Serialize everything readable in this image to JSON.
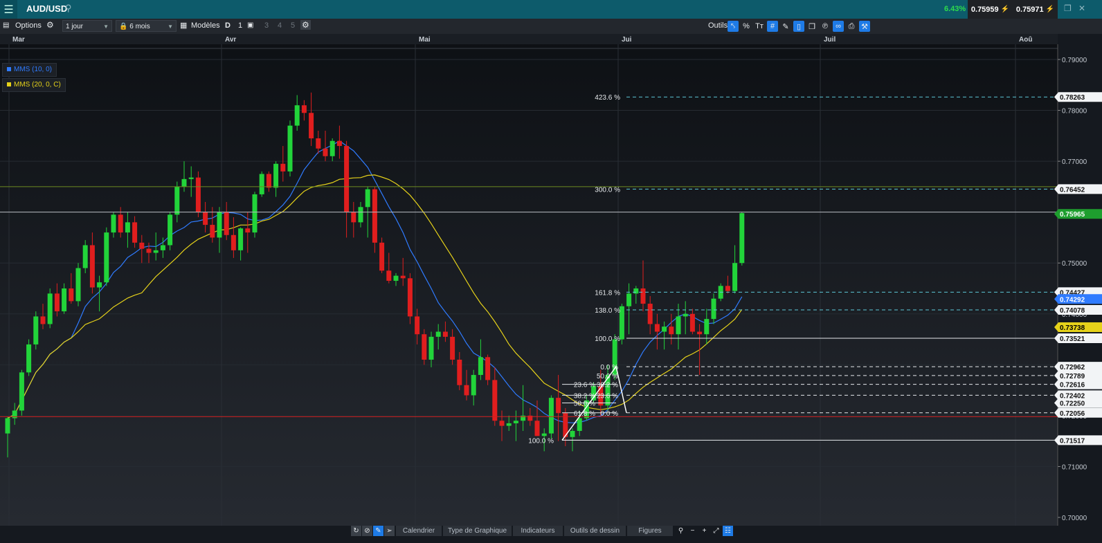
{
  "header": {
    "symbol": "AUD/USD",
    "change_pct": "6.43%",
    "bid": "0.75959",
    "ask": "0.75971"
  },
  "toolbar": {
    "options_label": "Options",
    "interval": "1 jour",
    "period": "6 mois",
    "models_label": "Modèles",
    "layout_d": "D",
    "layout_1": "1",
    "layout_3": "3",
    "layout_4": "4",
    "layout_5": "5",
    "tools_label": "Outils",
    "percent_label": "%",
    "text_tool_label": "Tт"
  },
  "legend": {
    "ma10": "MMS (10, 0)",
    "ma20": "MMS (20, 0, C)"
  },
  "colors": {
    "up": "#22d43a",
    "down": "#e01e1e",
    "ma10": "#2f7bff",
    "ma20": "#e6d21a",
    "accent": "#1e7be6"
  },
  "chart_data": {
    "type": "candlestick",
    "instrument": "AUD/USD",
    "months": [
      "Mar",
      "Avr",
      "Mai",
      "Jui",
      "Juil",
      "Aoû"
    ],
    "y_ticks": [
      "0.79000",
      "0.78000",
      "0.77000",
      "0.76000",
      "0.75000",
      "0.74000",
      "0.73000",
      "0.72000",
      "0.71000",
      "0.70000"
    ],
    "price_tags": [
      "0.78263",
      "0.76452",
      "0.75965",
      "0.74427",
      "0.74292",
      "0.74078",
      "0.73738",
      "0.73521",
      "0.72962",
      "0.72789",
      "0.72616",
      "0.72402",
      "0.72250",
      "0.72056",
      "0.71517"
    ],
    "fib_right": [
      {
        "label": "423.6 %",
        "price": 0.78263
      },
      {
        "label": "300.0 %",
        "price": 0.76452
      },
      {
        "label": "161.8 %",
        "price": 0.74427
      },
      {
        "label": "138.0 %",
        "price": 0.74078
      },
      {
        "label": "100.0 %",
        "price": 0.73521
      },
      {
        "label": "0.0 %",
        "price": 0.72962
      },
      {
        "label": "50.0 %",
        "price": 0.72789
      },
      {
        "label": "38.2 %",
        "price": 0.72616
      },
      {
        "label": "23.6 %",
        "price": 0.72402
      },
      {
        "label": "0.0 %",
        "price": 0.72056
      }
    ],
    "fib_left": [
      {
        "label": "23.6 %",
        "price": 0.72616
      },
      {
        "label": "38.2 %",
        "price": 0.72402
      },
      {
        "label": "50.0 %",
        "price": 0.7225
      },
      {
        "label": "61.8 %",
        "price": 0.72056
      },
      {
        "label": "100.0 %",
        "price": 0.71517
      }
    ],
    "horizontal_lines": [
      0.765,
      0.76,
      0.7198
    ],
    "ohlc": [
      [
        0.7165,
        0.7198,
        0.7118,
        0.7195
      ],
      [
        0.7195,
        0.7225,
        0.7182,
        0.721
      ],
      [
        0.721,
        0.729,
        0.72,
        0.7285
      ],
      [
        0.7285,
        0.735,
        0.7278,
        0.734
      ],
      [
        0.734,
        0.7405,
        0.733,
        0.7395
      ],
      [
        0.7395,
        0.742,
        0.737,
        0.738
      ],
      [
        0.738,
        0.745,
        0.7372,
        0.744
      ],
      [
        0.744,
        0.746,
        0.7395,
        0.7405
      ],
      [
        0.7405,
        0.746,
        0.74,
        0.745
      ],
      [
        0.745,
        0.748,
        0.742,
        0.7425
      ],
      [
        0.7425,
        0.75,
        0.7415,
        0.749
      ],
      [
        0.749,
        0.7545,
        0.748,
        0.7535
      ],
      [
        0.7535,
        0.756,
        0.744,
        0.7452
      ],
      [
        0.7452,
        0.7475,
        0.7405,
        0.7462
      ],
      [
        0.7462,
        0.757,
        0.7455,
        0.756
      ],
      [
        0.756,
        0.76,
        0.755,
        0.7595
      ],
      [
        0.7595,
        0.761,
        0.755,
        0.756
      ],
      [
        0.756,
        0.76,
        0.753,
        0.758
      ],
      [
        0.758,
        0.7592,
        0.753,
        0.754
      ],
      [
        0.754,
        0.7555,
        0.75,
        0.7528
      ],
      [
        0.7528,
        0.754,
        0.75,
        0.752
      ],
      [
        0.752,
        0.756,
        0.7505,
        0.7525
      ],
      [
        0.7525,
        0.755,
        0.751,
        0.7535
      ],
      [
        0.7535,
        0.76,
        0.7525,
        0.7595
      ],
      [
        0.7595,
        0.766,
        0.758,
        0.765
      ],
      [
        0.765,
        0.77,
        0.764,
        0.7665
      ],
      [
        0.7665,
        0.769,
        0.763,
        0.7668
      ],
      [
        0.7668,
        0.768,
        0.759,
        0.76
      ],
      [
        0.76,
        0.762,
        0.756,
        0.7575
      ],
      [
        0.7575,
        0.761,
        0.754,
        0.755
      ],
      [
        0.755,
        0.761,
        0.752,
        0.76
      ],
      [
        0.76,
        0.762,
        0.7545,
        0.7555
      ],
      [
        0.7555,
        0.759,
        0.751,
        0.7525
      ],
      [
        0.7525,
        0.757,
        0.7505,
        0.7568
      ],
      [
        0.7568,
        0.76,
        0.752,
        0.756
      ],
      [
        0.756,
        0.764,
        0.755,
        0.7635
      ],
      [
        0.7635,
        0.768,
        0.763,
        0.7675
      ],
      [
        0.7675,
        0.768,
        0.764,
        0.7648
      ],
      [
        0.7648,
        0.77,
        0.763,
        0.7695
      ],
      [
        0.7695,
        0.773,
        0.766,
        0.768
      ],
      [
        0.768,
        0.778,
        0.767,
        0.777
      ],
      [
        0.777,
        0.783,
        0.776,
        0.781
      ],
      [
        0.781,
        0.782,
        0.778,
        0.7795
      ],
      [
        0.7795,
        0.7835,
        0.773,
        0.7745
      ],
      [
        0.7745,
        0.776,
        0.7715,
        0.7725
      ],
      [
        0.7725,
        0.776,
        0.77,
        0.771
      ],
      [
        0.771,
        0.7745,
        0.77,
        0.774
      ],
      [
        0.774,
        0.777,
        0.7705,
        0.773
      ],
      [
        0.773,
        0.774,
        0.755,
        0.76
      ],
      [
        0.76,
        0.762,
        0.755,
        0.758
      ],
      [
        0.758,
        0.762,
        0.757,
        0.761
      ],
      [
        0.761,
        0.765,
        0.755,
        0.7645
      ],
      [
        0.7645,
        0.765,
        0.752,
        0.754
      ],
      [
        0.754,
        0.755,
        0.748,
        0.7485
      ],
      [
        0.7485,
        0.752,
        0.746,
        0.7465
      ],
      [
        0.7465,
        0.748,
        0.7455,
        0.7475
      ],
      [
        0.7475,
        0.751,
        0.7455,
        0.747
      ],
      [
        0.747,
        0.748,
        0.738,
        0.7395
      ],
      [
        0.7395,
        0.741,
        0.734,
        0.736
      ],
      [
        0.736,
        0.737,
        0.73,
        0.731
      ],
      [
        0.731,
        0.7365,
        0.7295,
        0.7355
      ],
      [
        0.7355,
        0.738,
        0.733,
        0.7365
      ],
      [
        0.7365,
        0.7385,
        0.7345,
        0.7355
      ],
      [
        0.7355,
        0.737,
        0.73,
        0.731
      ],
      [
        0.731,
        0.7325,
        0.725,
        0.726
      ],
      [
        0.726,
        0.729,
        0.723,
        0.724
      ],
      [
        0.724,
        0.729,
        0.722,
        0.728
      ],
      [
        0.728,
        0.735,
        0.727,
        0.7315
      ],
      [
        0.7315,
        0.732,
        0.726,
        0.727
      ],
      [
        0.727,
        0.7295,
        0.718,
        0.719
      ],
      [
        0.719,
        0.721,
        0.715,
        0.718
      ],
      [
        0.718,
        0.72,
        0.717,
        0.7185
      ],
      [
        0.7185,
        0.721,
        0.715,
        0.719
      ],
      [
        0.719,
        0.726,
        0.717,
        0.72
      ],
      [
        0.72,
        0.7215,
        0.718,
        0.719
      ],
      [
        0.719,
        0.723,
        0.716,
        0.716
      ],
      [
        0.716,
        0.7175,
        0.713,
        0.7165
      ],
      [
        0.7165,
        0.724,
        0.7155,
        0.7235
      ],
      [
        0.7235,
        0.728,
        0.715,
        0.7205
      ],
      [
        0.7205,
        0.7215,
        0.714,
        0.7158
      ],
      [
        0.7158,
        0.7175,
        0.713,
        0.717
      ],
      [
        0.717,
        0.721,
        0.716,
        0.7195
      ],
      [
        0.7195,
        0.724,
        0.719,
        0.723
      ],
      [
        0.723,
        0.7265,
        0.7225,
        0.7258
      ],
      [
        0.7258,
        0.729,
        0.72,
        0.722
      ],
      [
        0.722,
        0.73,
        0.721,
        0.728
      ],
      [
        0.728,
        0.736,
        0.727,
        0.735
      ],
      [
        0.735,
        0.742,
        0.734,
        0.7415
      ],
      [
        0.7415,
        0.746,
        0.736,
        0.744
      ],
      [
        0.744,
        0.7455,
        0.742,
        0.745
      ],
      [
        0.745,
        0.7505,
        0.7405,
        0.742
      ],
      [
        0.742,
        0.7435,
        0.736,
        0.738
      ],
      [
        0.738,
        0.74,
        0.733,
        0.7365
      ],
      [
        0.7365,
        0.7385,
        0.733,
        0.7375
      ],
      [
        0.7375,
        0.74,
        0.734,
        0.736
      ],
      [
        0.736,
        0.742,
        0.733,
        0.7395
      ],
      [
        0.7395,
        0.7425,
        0.736,
        0.74
      ],
      [
        0.74,
        0.741,
        0.736,
        0.7365
      ],
      [
        0.7365,
        0.738,
        0.728,
        0.736
      ],
      [
        0.736,
        0.741,
        0.734,
        0.739
      ],
      [
        0.739,
        0.744,
        0.738,
        0.743
      ],
      [
        0.743,
        0.746,
        0.7425,
        0.7455
      ],
      [
        0.7455,
        0.7475,
        0.744,
        0.7445
      ],
      [
        0.7445,
        0.7535,
        0.744,
        0.75
      ],
      [
        0.75,
        0.76,
        0.7495,
        0.7598
      ]
    ],
    "ma10_last": 0.74292,
    "ma20_last": 0.73738,
    "last_price": 0.75965
  },
  "bottom": {
    "tabs": [
      "Calendrier",
      "Type de Graphique",
      "Indicateurs",
      "Outils de dessin",
      "Figures"
    ]
  }
}
